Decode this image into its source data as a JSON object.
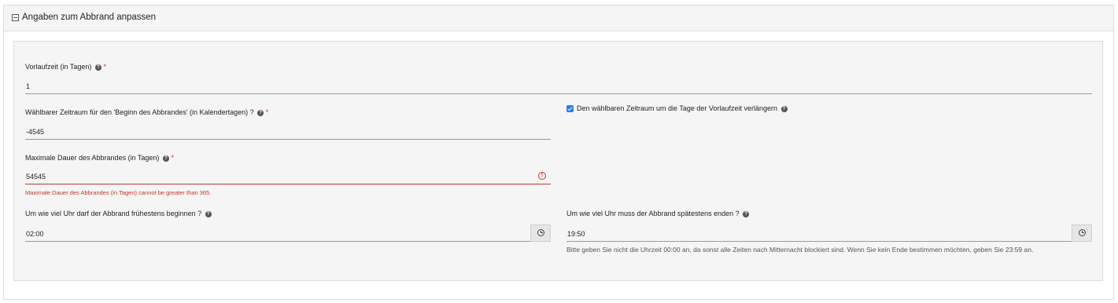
{
  "panel": {
    "title": "Angaben zum Abbrand anpassen"
  },
  "fields": {
    "vorlaufzeit": {
      "label": "Vorlaufzeit (in Tagen)",
      "value": "1"
    },
    "zeitraum": {
      "label": "Wählbarer Zeitraum für den 'Beginn des Abbrandes' (in Kalendertagen) ?",
      "value": "-4545"
    },
    "dauer": {
      "label": "Maximale Dauer des Abbrandes (in Tagen)",
      "value": "54545",
      "error": "Maximale Dauer des Abbrandes (in Tagen) cannot be greater than 365."
    },
    "beginn": {
      "label": "Um wie viel Uhr darf der Abbrand frühestens beginnen ?",
      "value": "02:00"
    },
    "ende": {
      "label": "Um wie viel Uhr muss der Abbrand spätestens enden ?",
      "value": "19:50",
      "hint": "Bitte geben Sie nicht die Uhrzeit 00:00 an, da sonst alle Zeiten nach Mitternacht blockiert sind. Wenn Sie kein Ende bestimmen möchten, geben Sie 23:59 an."
    },
    "verlaengern": {
      "label": "Den wählbaren Zeitraum um die Tage der Vorlaufzeit verlängern",
      "checked": true
    }
  },
  "required_marker": "*",
  "help_glyph": "?",
  "error_glyph": "!",
  "colors": {
    "accent": "#2c7be5",
    "error": "#c0392b"
  }
}
